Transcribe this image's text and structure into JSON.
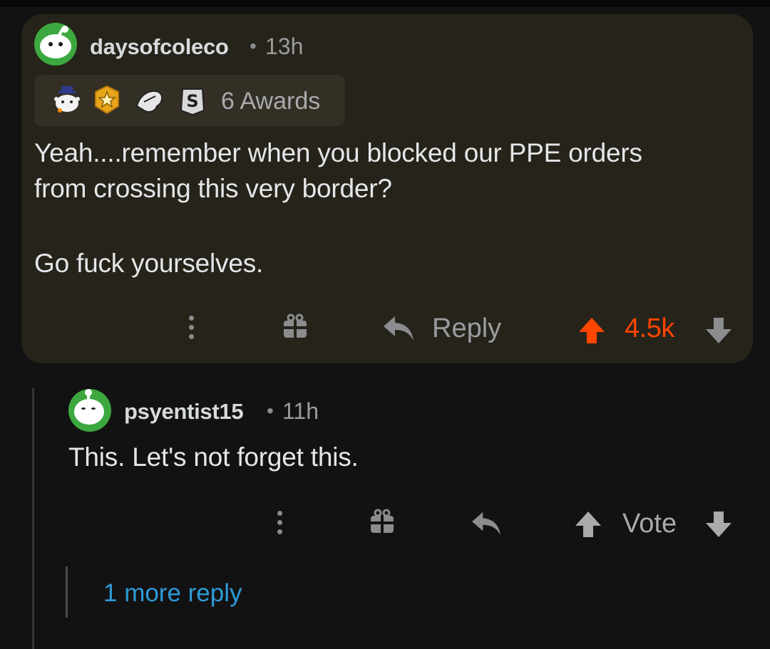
{
  "comment1": {
    "username": "daysofcoleco",
    "separator": "•",
    "time": "13h",
    "awards_count": "6 Awards",
    "awards": [
      "wholesome-award-icon",
      "gold-award-icon",
      "helpful-hand-award-icon",
      "silver-award-icon"
    ],
    "body_line1": "Yeah....remember when you blocked our PPE orders",
    "body_line2": "from crossing this very border?",
    "body_line3": "Go fuck yourselves.",
    "reply_label": "Reply",
    "score": "4.5k",
    "score_color": "#ff4500"
  },
  "comment2": {
    "username": "psyentist15",
    "separator": "•",
    "time": "11h",
    "body": "This. Let's not forget this.",
    "vote_label": "Vote"
  },
  "more_replies": "1 more reply",
  "colors": {
    "background": "#121212",
    "card": "#26231a",
    "link": "#2e9bd8",
    "avatar_green": "#3ca83f"
  }
}
